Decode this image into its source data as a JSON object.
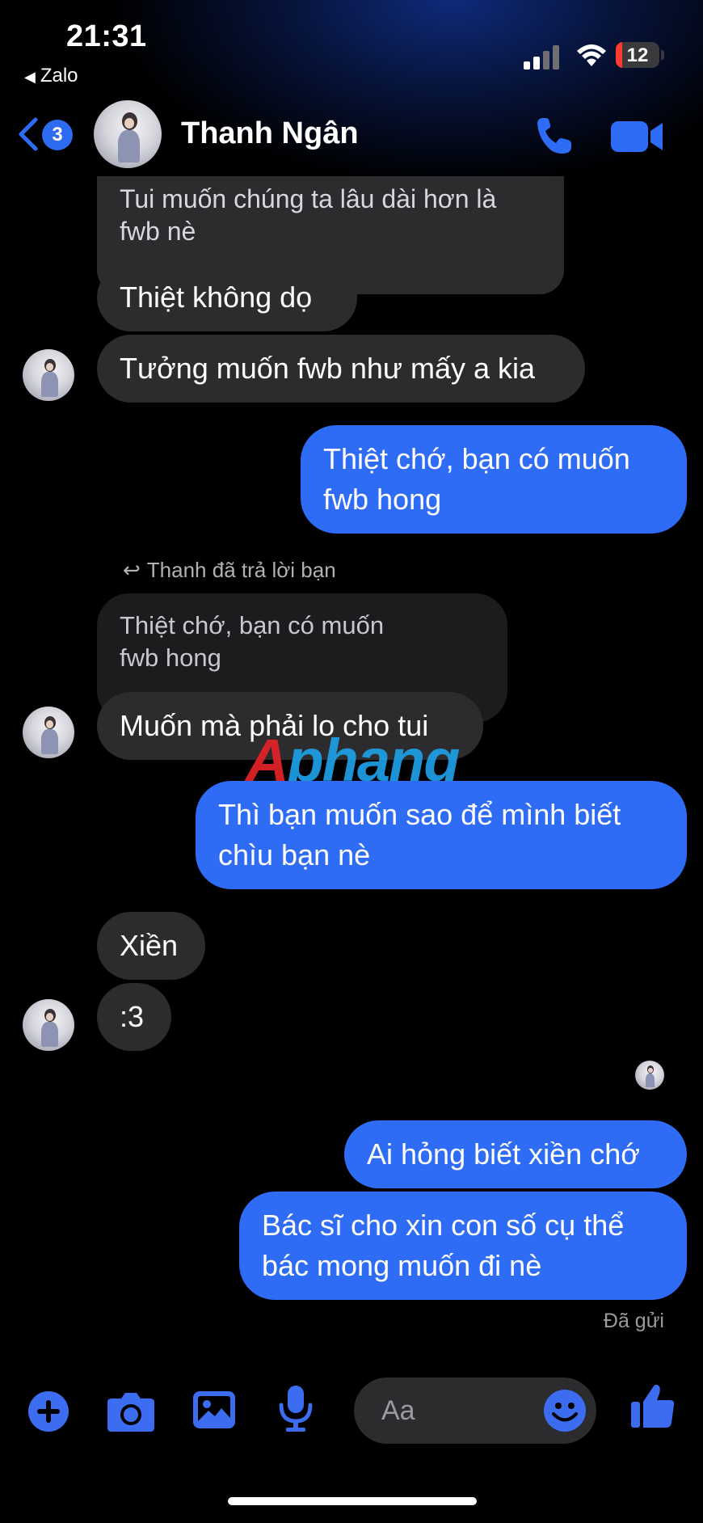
{
  "status_bar": {
    "time": "21:31",
    "back_app": "Zalo",
    "battery": "12",
    "battery_level": 0.12
  },
  "header": {
    "back_count": "3",
    "contact_name": "Thanh Ngân"
  },
  "messages": {
    "m1": "Tui muốn chúng ta lâu dài hơn là\nfwb nè",
    "m2": "Thiệt không dọ",
    "m3": "Tưởng muốn fwb như mấy a kia",
    "m4": "Thiệt chớ, bạn có muốn\nfwb hong",
    "reply_note": "Thanh đã trả lời bạn",
    "quote": "Thiệt chớ, bạn có muốn\nfwb hong",
    "m5": "Muốn mà phải lo cho tui",
    "m6": "Thì bạn muốn sao để mình biết\nchìu bạn nè",
    "m7": "Xiền",
    "m8": ":3",
    "m9": "Ai hỏng biết xiền chớ",
    "m10": "Bác sĩ cho xin con số cụ thể\nbác mong muốn đi nè",
    "sent": "Đã gửi"
  },
  "watermark": {
    "part1": "A",
    "part2": "phang"
  },
  "composer": {
    "placeholder": "Aa"
  },
  "colors": {
    "accent": "#2f6cf6",
    "incoming": "#2c2c2e",
    "icon_blue": "#3c6cf0"
  },
  "icons": [
    "back-chevron-icon",
    "phone-icon",
    "video-camera-icon",
    "plus-icon",
    "camera-icon",
    "image-icon",
    "microphone-icon",
    "emoji-icon",
    "thumbs-up-icon",
    "reply-arrow-icon"
  ]
}
